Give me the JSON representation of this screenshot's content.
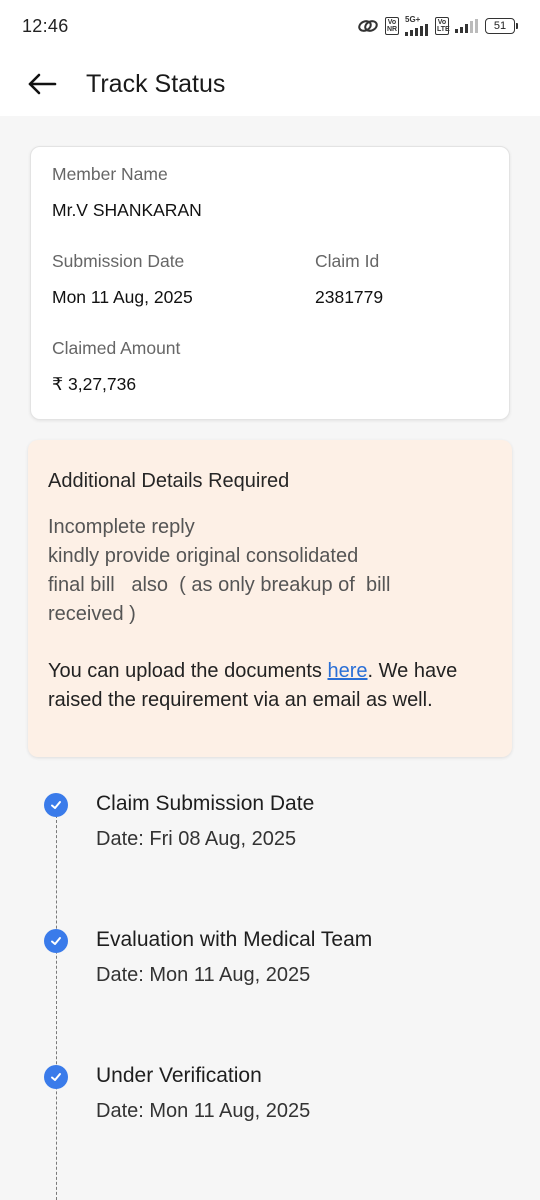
{
  "status_bar": {
    "time": "12:46",
    "net1_top": "Vo",
    "net1_bottom": "NR",
    "net1_type": "5G+",
    "net2_top": "Vo",
    "net2_bottom": "LTE",
    "battery": "51"
  },
  "header": {
    "title": "Track Status"
  },
  "member_card": {
    "member_name_label": "Member Name",
    "member_name": "Mr.V SHANKARAN",
    "submission_date_label": "Submission Date",
    "submission_date": "Mon 11 Aug, 2025",
    "claim_id_label": "Claim Id",
    "claim_id": "2381779",
    "claimed_amount_label": "Claimed Amount",
    "claimed_amount": "₹ 3,27,736"
  },
  "notice": {
    "heading": "Additional Details Required",
    "reply": "Incomplete reply\nkindly provide original consolidated\nfinal bill   also  ( as only breakup of  bill\nreceived )",
    "upload_prefix": "You can upload the documents ",
    "upload_link": "here",
    "upload_suffix": ". We have raised the requirement via an email as well."
  },
  "timeline": [
    {
      "title": "Claim Submission Date",
      "date": "Date: Fri 08 Aug, 2025"
    },
    {
      "title": "Evaluation with Medical Team",
      "date": "Date: Mon 11 Aug, 2025"
    },
    {
      "title": "Under Verification",
      "date": "Date: Mon 11 Aug, 2025"
    }
  ],
  "colors": {
    "accent": "#3a7bea",
    "notice_bg": "#fdf0e6",
    "link": "#2a6fd6"
  }
}
